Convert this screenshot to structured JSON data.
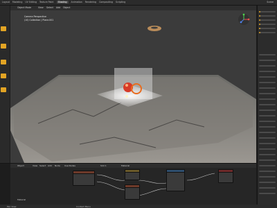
{
  "topbar": {
    "menu": [
      "Layout",
      "Modeling",
      "UV Editing",
      "Texture Paint",
      "Shading",
      "Animation",
      "Rendering",
      "Compositing",
      "Scripting"
    ],
    "active_index": 4,
    "scene_label": "Scene"
  },
  "viewport": {
    "header": [
      "Object Mode",
      "View",
      "Select",
      "Add",
      "Object"
    ],
    "overlay_line1": "Camera Perspective",
    "overlay_line2": "(10) Collection | Plane.001"
  },
  "node_editor": {
    "header": [
      "Object",
      "View",
      "Select",
      "Add",
      "Node",
      "Use Nodes",
      "Slot 1",
      "Material"
    ],
    "footer_label": "Material"
  },
  "statusbar": {
    "left": "Pan View",
    "mid": "Context Menu"
  },
  "colors": {
    "accent_orange": "#e2a424",
    "ui_dark": "#2b2b2b"
  }
}
